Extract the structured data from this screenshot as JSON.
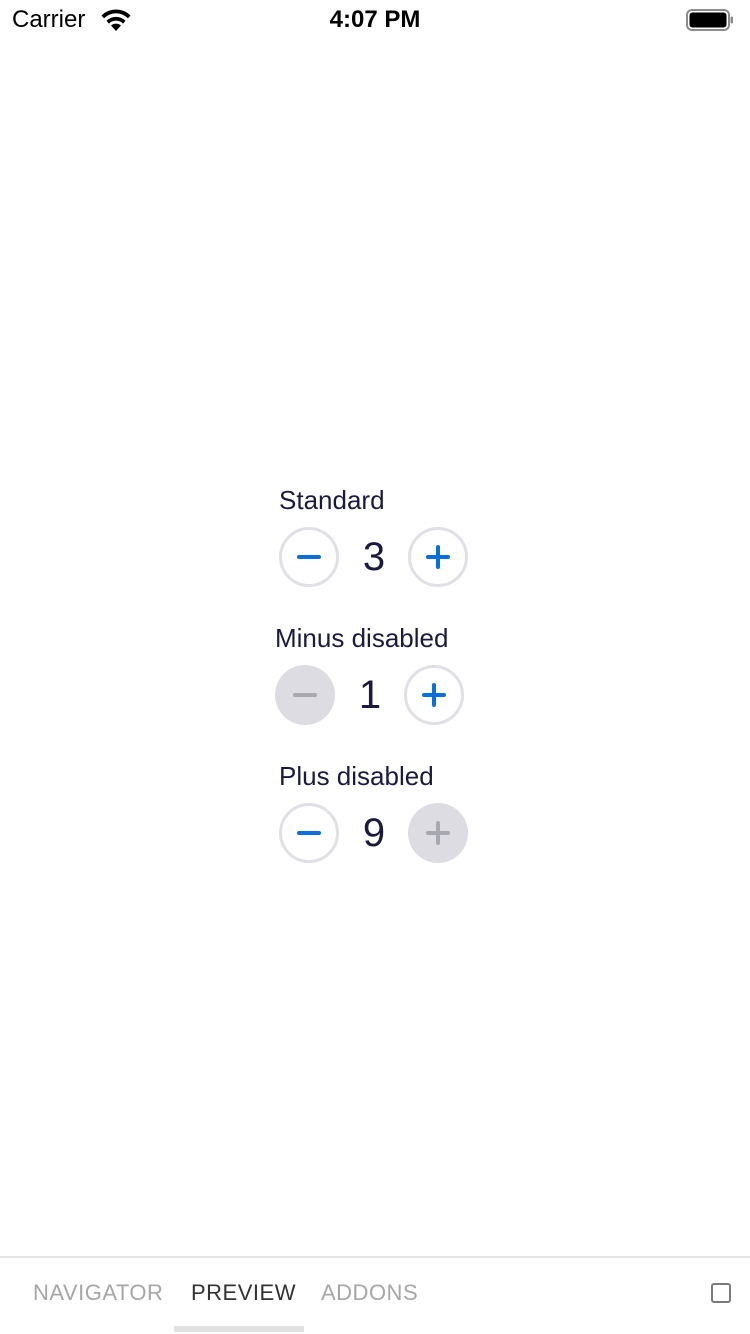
{
  "status_bar": {
    "carrier": "Carrier",
    "time": "4:07 PM",
    "wifi_icon": "wifi-icon",
    "battery_icon": "battery-icon"
  },
  "colors": {
    "accent": "#0a6fdd",
    "disabled_icon": "#a8a8b0",
    "disabled_bg": "#dcdce2",
    "border": "#e0e0e6",
    "text": "#1b1a3e"
  },
  "steppers": [
    {
      "label": "Standard",
      "value": "3",
      "minus_disabled": false,
      "plus_disabled": false
    },
    {
      "label": "Minus disabled",
      "value": "1",
      "minus_disabled": true,
      "plus_disabled": false
    },
    {
      "label": "Plus disabled",
      "value": "9",
      "minus_disabled": false,
      "plus_disabled": true
    }
  ],
  "tab_bar": {
    "tabs": [
      {
        "label": "NAVIGATOR",
        "active": false
      },
      {
        "label": "PREVIEW",
        "active": true
      },
      {
        "label": "ADDONS",
        "active": false
      }
    ],
    "toggle_icon": "checkbox-icon"
  }
}
